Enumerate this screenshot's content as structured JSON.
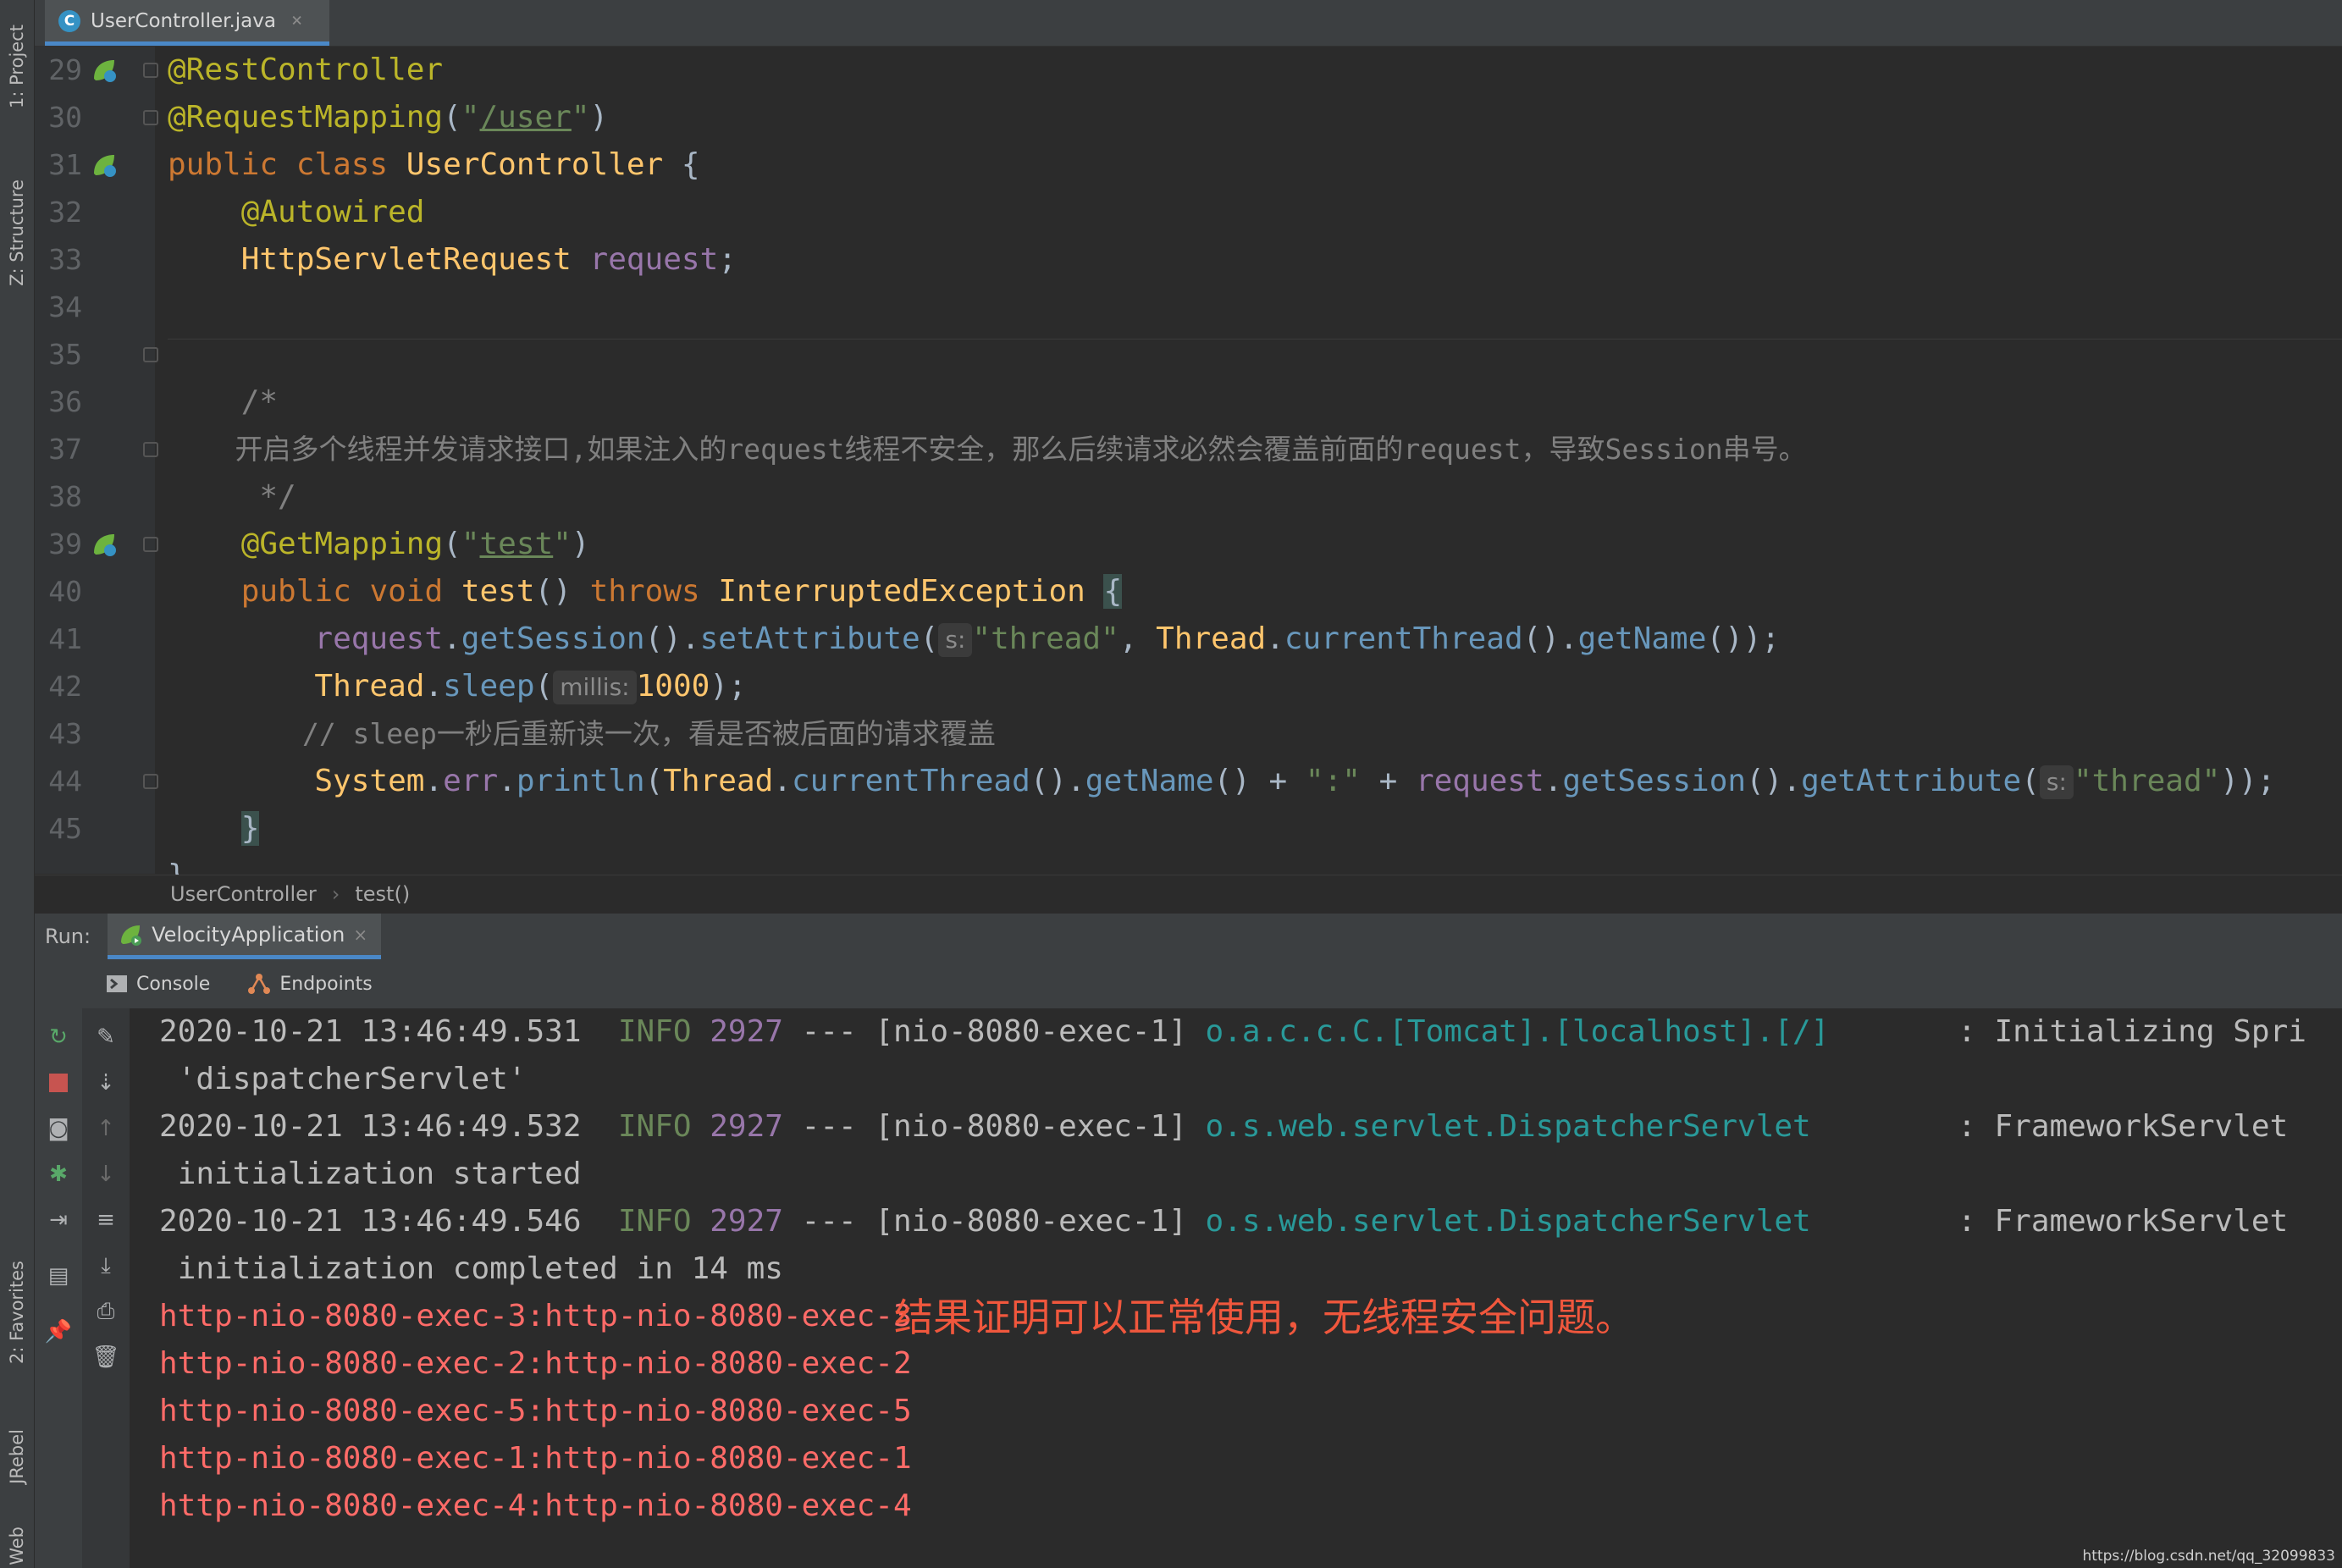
{
  "tool_windows": {
    "project": "1: Project",
    "structure": "Z: Structure",
    "favorites": "2: Favorites",
    "jrebel": "JRebel",
    "web": "Web"
  },
  "editor_tab": {
    "file_icon": "C",
    "filename": "UserController.java",
    "close": "×"
  },
  "editor": {
    "line_numbers": [
      "29",
      "30",
      "31",
      "32",
      "33",
      "34",
      "35",
      "36",
      "37",
      "38",
      "39",
      "40",
      "41",
      "42",
      "43",
      "44",
      "45"
    ],
    "lines": {
      "l29": {
        "ann": "@RestController"
      },
      "l30": {
        "ann": "@RequestMapping",
        "p1": "(",
        "q1": "\"",
        "url": "/user",
        "q2": "\"",
        "p2": ")"
      },
      "l31": {
        "kw1": "public",
        "kw2": "class",
        "cls": "UserController",
        "brace": "{"
      },
      "l32": {
        "ann": "@Autowired"
      },
      "l33": {
        "type": "HttpServletRequest",
        "field": "request",
        "semi": ";"
      },
      "l35": {
        "cmt": "/*"
      },
      "l36": {
        "cmt": "开启多个线程并发请求接口,如果注入的request线程不安全，那么后续请求必然会覆盖前面的request，导致Session串号。"
      },
      "l37": {
        "cmt": " */"
      },
      "l38": {
        "ann": "@GetMapping",
        "p1": "(",
        "q1": "\"",
        "url": "test",
        "q2": "\"",
        "p2": ")"
      },
      "l39": {
        "kw1": "public",
        "kw2": "void",
        "mth": "test",
        "parens": "()",
        "kw3": "throws",
        "exc": "InterruptedException",
        "brace": "{"
      },
      "l40": {
        "field": "request",
        "c1": ".",
        "m1": "getSession",
        "c2": "().",
        "m2": "setAttribute",
        "c3": "(",
        "hint": "s:",
        "str": "\"thread\"",
        "c4": ", ",
        "t1": "Thread",
        "c5": ".",
        "m3": "currentThread",
        "c6": "().",
        "m4": "getName",
        "c7": "());"
      },
      "l41": {
        "t1": "Thread",
        "c1": ".",
        "m1": "sleep",
        "c2": "(",
        "hint": "millis:",
        "num": "1000",
        "c3": ");"
      },
      "l42": {
        "cmt": "// sleep一秒后重新读一次，看是否被后面的请求覆盖"
      },
      "l43": {
        "t1": "System",
        "c1": ".",
        "f1": "err",
        "c2": ".",
        "m1": "println",
        "c3": "(",
        "t2": "Thread",
        "c4": ".",
        "m2": "currentThread",
        "c5": "().",
        "m3": "getName",
        "c6": "() + ",
        "str1": "\":\"",
        "c7": " + ",
        "field": "request",
        "c8": ".",
        "m4": "getSession",
        "c9": "().",
        "m5": "getAttribute",
        "c10": "(",
        "hint": "s:",
        "str2": "\"thread\"",
        "c11": "));"
      },
      "l44": {
        "brace": "}"
      },
      "l45": {
        "brace": "}"
      }
    }
  },
  "breadcrumb": {
    "class": "UserController",
    "sep": "›",
    "method": "test()"
  },
  "run": {
    "label": "Run:",
    "config": "VelocityApplication",
    "close": "×"
  },
  "console_tabs": {
    "console": "Console",
    "endpoints": "Endpoints"
  },
  "console": {
    "logs": [
      {
        "ts": "2020-10-21 13:46:49.531",
        "level": "INFO",
        "pid": "2927",
        "thread": "--- [nio-8080-exec-1]",
        "logger": "o.a.c.c.C.[Tomcat].[localhost].[/]",
        "msg": ": Initializing Spri",
        "cont": "'dispatcherServlet'"
      },
      {
        "ts": "2020-10-21 13:46:49.532",
        "level": "INFO",
        "pid": "2927",
        "thread": "--- [nio-8080-exec-1]",
        "logger": "o.s.web.servlet.DispatcherServlet",
        "msg": ": FrameworkServlet",
        "cont": "initialization started"
      },
      {
        "ts": "2020-10-21 13:46:49.546",
        "level": "INFO",
        "pid": "2927",
        "thread": "--- [nio-8080-exec-1]",
        "logger": "o.s.web.servlet.DispatcherServlet",
        "msg": ": FrameworkServlet",
        "cont": "initialization completed in 14 ms"
      }
    ],
    "errors": [
      "http-nio-8080-exec-3:http-nio-8080-exec-3",
      "http-nio-8080-exec-2:http-nio-8080-exec-2",
      "http-nio-8080-exec-5:http-nio-8080-exec-5",
      "http-nio-8080-exec-1:http-nio-8080-exec-1",
      "http-nio-8080-exec-4:http-nio-8080-exec-4"
    ]
  },
  "annotation_note": "结果证明可以正常使用，无线程安全问题。",
  "watermark": "https://blog.csdn.net/qq_32099833",
  "colors": {
    "accent": "#4a88c7",
    "note": "#f0573d",
    "error": "#ff6b68"
  },
  "icons": [
    "spring-bean-icon",
    "run-gutter-icon",
    "rerun-icon",
    "stop-icon",
    "camera-icon",
    "debug-icon",
    "exit-icon",
    "layout-icon",
    "pin-icon",
    "edit-icon",
    "scroll-to-end-icon",
    "up-arrow-icon",
    "down-arrow-icon",
    "soft-wrap-icon",
    "print-icon",
    "trash-icon",
    "console-icon",
    "endpoints-icon"
  ]
}
